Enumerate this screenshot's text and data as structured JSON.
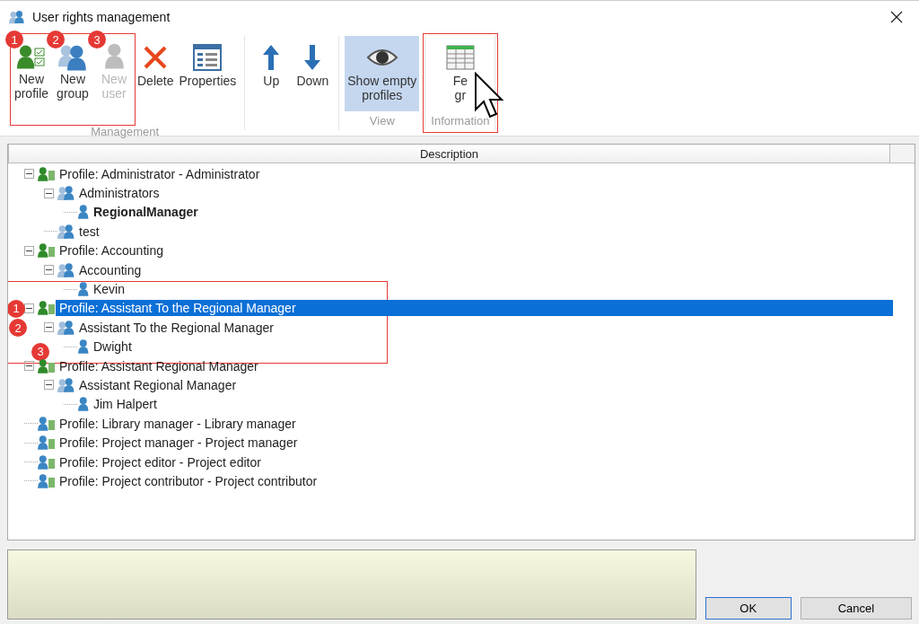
{
  "window": {
    "title": "User rights management"
  },
  "toolbar": {
    "groups": [
      {
        "label": "Management",
        "buttons": [
          {
            "kind": "profile",
            "lines": [
              "New",
              "profile"
            ],
            "disabled": false,
            "badge": "1",
            "outlined": true
          },
          {
            "kind": "group",
            "lines": [
              "New",
              "group"
            ],
            "disabled": false,
            "badge": "2",
            "outlined": true
          },
          {
            "kind": "user",
            "lines": [
              "New",
              "user"
            ],
            "disabled": true,
            "badge": "3",
            "outlined": true
          },
          {
            "kind": "delete",
            "lines": [
              "Delete"
            ],
            "disabled": false,
            "outlined": false
          },
          {
            "kind": "properties",
            "lines": [
              "Properties"
            ],
            "disabled": false,
            "outlined": false
          }
        ]
      },
      {
        "buttons": [
          {
            "kind": "up",
            "lines": [
              "Up"
            ],
            "disabled": false,
            "outlined": false
          },
          {
            "kind": "down",
            "lines": [
              "Down"
            ],
            "disabled": false,
            "outlined": false
          }
        ]
      },
      {
        "label": "View",
        "buttons": [
          {
            "kind": "eye",
            "lines": [
              "Show empty",
              "profiles"
            ],
            "disabled": false,
            "on": true,
            "outlined": false
          }
        ]
      },
      {
        "label": "Information",
        "outlined": true,
        "buttons": [
          {
            "kind": "table",
            "lines": [
              "Fe",
              "gr"
            ],
            "disabled": false,
            "outlined": false
          }
        ]
      }
    ]
  },
  "tree": {
    "column": "Description",
    "nodes": [
      {
        "kind": "profile",
        "text": "Profile: Administrator - Administrator",
        "expanded": true,
        "selected": false,
        "children": [
          {
            "kind": "group",
            "text": "Administrators",
            "expanded": true,
            "selected": false,
            "children": [
              {
                "kind": "user",
                "text": "RegionalManager",
                "bold": true,
                "selected": false
              }
            ]
          },
          {
            "kind": "group",
            "text": "test",
            "selected": false
          }
        ]
      },
      {
        "kind": "profile",
        "text": "Profile: Accounting",
        "expanded": true,
        "selected": false,
        "children": [
          {
            "kind": "group",
            "text": "Accounting",
            "expanded": true,
            "selected": false,
            "children": [
              {
                "kind": "user",
                "text": "Kevin",
                "selected": false
              }
            ]
          }
        ]
      },
      {
        "kind": "profile",
        "text": "Profile: Assistant To the Regional Manager",
        "expanded": true,
        "selected": true,
        "badge": "1",
        "outlined": true,
        "children": [
          {
            "kind": "group",
            "text": "Assistant To the Regional Manager",
            "expanded": true,
            "selected": false,
            "badge": "2",
            "children": [
              {
                "kind": "user",
                "text": "Dwight",
                "selected": false,
                "badge": "3"
              }
            ]
          }
        ]
      },
      {
        "kind": "profile",
        "text": "Profile: Assistant Regional Manager",
        "expanded": true,
        "selected": false,
        "children": [
          {
            "kind": "group",
            "text": "Assistant Regional Manager",
            "expanded": true,
            "selected": false,
            "children": [
              {
                "kind": "user",
                "text": "Jim Halpert",
                "selected": false
              }
            ]
          }
        ]
      },
      {
        "kind": "profile-empty",
        "text": "Profile: Library manager - Library manager",
        "selected": false
      },
      {
        "kind": "profile-empty",
        "text": "Profile: Project manager - Project manager",
        "selected": false
      },
      {
        "kind": "profile-empty",
        "text": "Profile: Project editor - Project editor",
        "selected": false
      },
      {
        "kind": "profile-empty",
        "text": "Profile: Project contributor - Project contributor",
        "selected": false
      }
    ]
  },
  "buttons": [
    {
      "kind": "default",
      "label": "OK"
    },
    {
      "kind": "normal",
      "label": "Cancel"
    }
  ]
}
